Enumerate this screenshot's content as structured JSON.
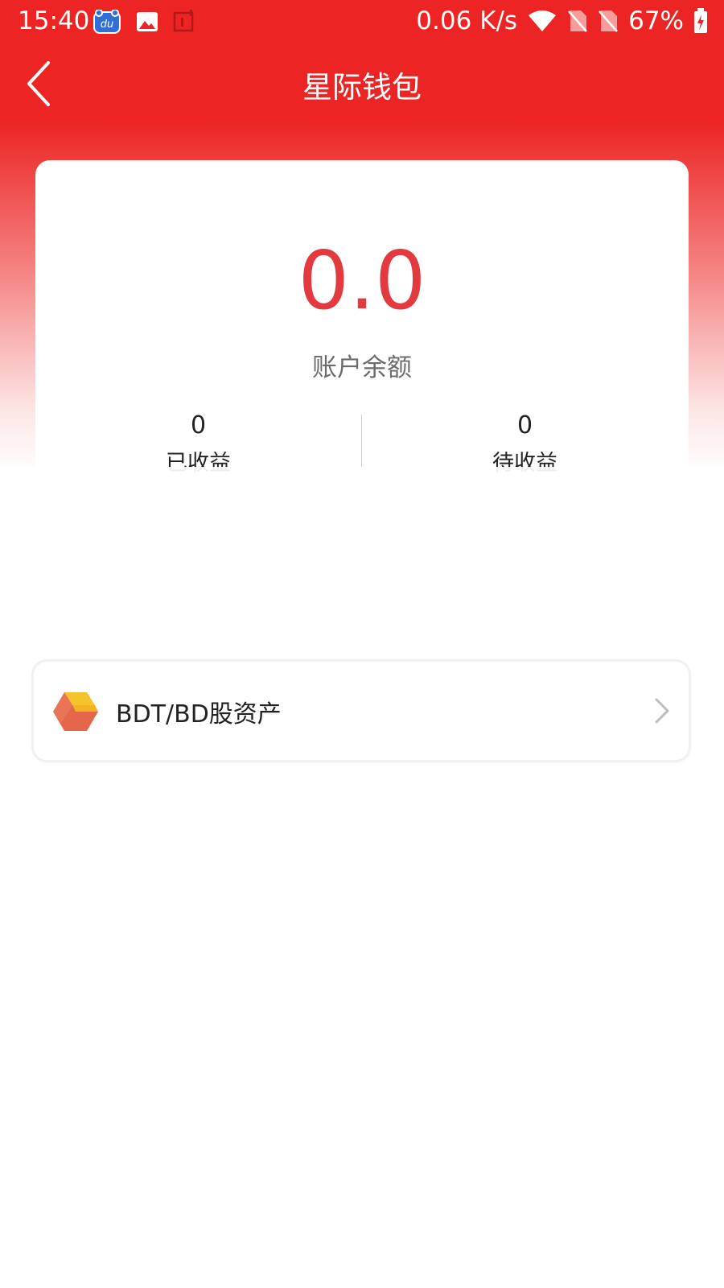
{
  "status_bar": {
    "time": "15:40",
    "network_speed": "0.06 K/s",
    "battery": "67%"
  },
  "header": {
    "title": "星际钱包"
  },
  "wallet": {
    "balance": "0.0",
    "balance_label": "账户余额",
    "earned_value": "0",
    "earned_label": "已收益",
    "pending_value": "0",
    "pending_label": "待收益"
  },
  "assets": {
    "row_label": "BDT/BD股资产"
  },
  "colors": {
    "brand_red": "#ec2423",
    "balance_red": "#e23a3f"
  }
}
